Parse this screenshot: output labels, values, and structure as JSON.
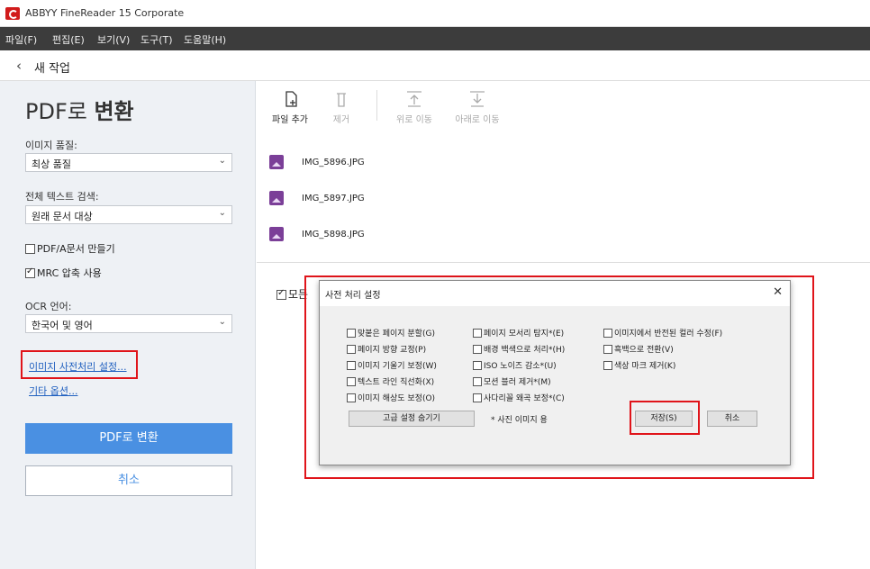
{
  "window": {
    "title": "ABBYY FineReader 15 Corporate"
  },
  "menu": [
    "파일(F)",
    "편집(E)",
    "보기(V)",
    "도구(T)",
    "도움말(H)"
  ],
  "nav": {
    "back_icon": "chevron-left-icon",
    "label": "새 작업"
  },
  "left": {
    "heading_light": "PDF로 ",
    "heading_bold": "변환",
    "quality_label": "이미지 품질:",
    "quality_value": "최상 품질",
    "search_label": "전체 텍스트 검색:",
    "search_value": "원래 문서 대상",
    "pdfa_label": "PDF/A문서 만들기",
    "mrc_label": "MRC 압축 사용",
    "ocr_label": "OCR 언어:",
    "ocr_value": "한국어 및 영어",
    "preprocess_link": "이미지 사전처리 설정...",
    "other_link": "기타 옵션...",
    "convert_button": "PDF로 변환",
    "cancel_button": "취소"
  },
  "toolbar": {
    "add": "파일 추가",
    "remove": "제거",
    "up": "위로 이동",
    "down": "아래로 이동"
  },
  "files": [
    "IMG_5896.JPG",
    "IMG_5897.JPG",
    "IMG_5898.JPG"
  ],
  "background_check": "모든",
  "dialog": {
    "title": "사전 처리 설정",
    "col1": [
      "맞붙은 페이지 분할(G)",
      "페이지 방향 교정(P)",
      "이미지 기울기 보정(W)",
      "텍스트 라인 직선화(X)",
      "이미지 해상도 보정(O)"
    ],
    "col2": [
      "페이지 모서리 탐지*(E)",
      "배경 백색으로 처리*(H)",
      "ISO 노이즈 감소*(U)",
      "모션 블러 제거*(M)",
      "사다리꼴 왜곡 보정*(C)"
    ],
    "col3": [
      "이미지에서 반전된 컬러 수정(F)",
      "흑백으로 전환(V)",
      "색상 마크 제거(K)"
    ],
    "hide_advanced": "고급 설정 숨기기",
    "note": "* 사진 이미지 용",
    "save": "저장(S)",
    "cancel": "취소"
  },
  "colors": {
    "accent": "#4a90e2",
    "highlight": "#e0141a",
    "menubar": "#3c3c3c",
    "link": "#1f5fbf"
  }
}
